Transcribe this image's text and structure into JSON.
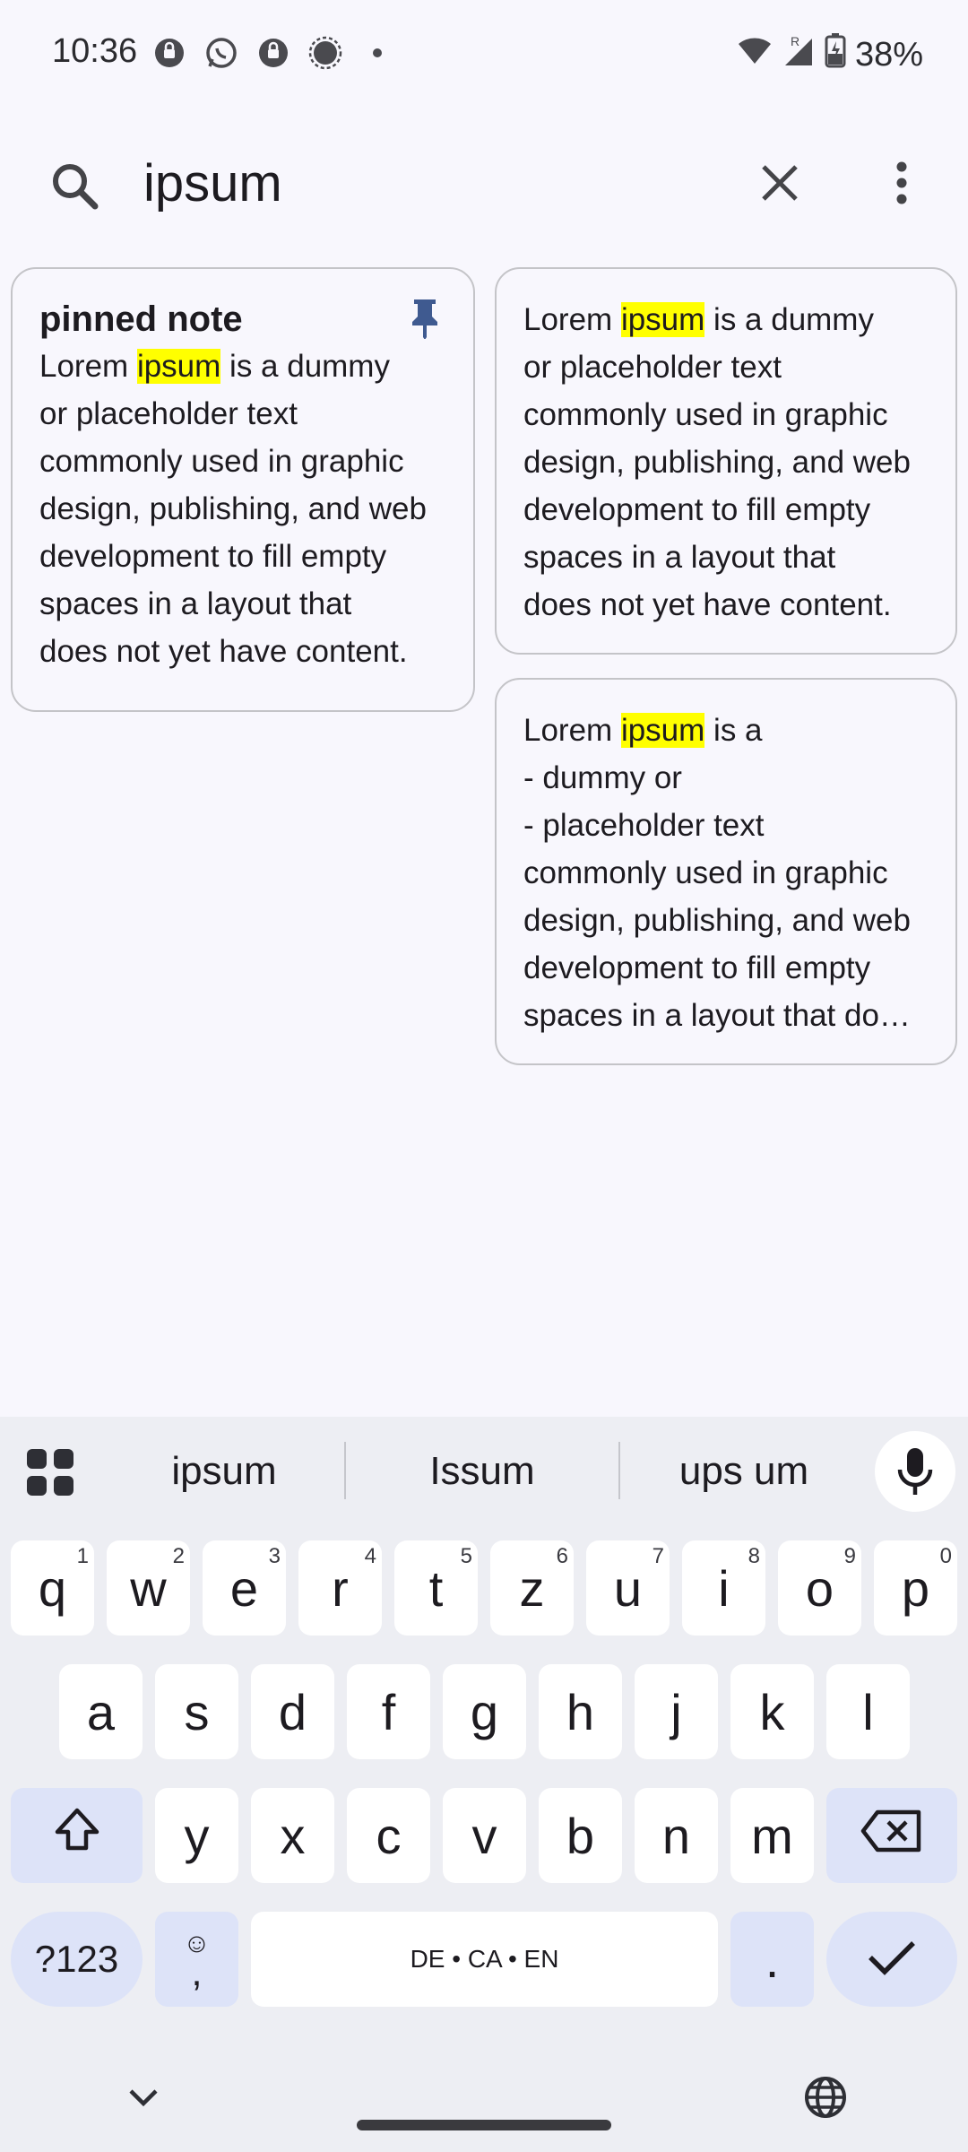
{
  "status_bar": {
    "time": "10:36",
    "battery": "38%",
    "notification_icons": [
      "signal-chat-icon",
      "whatsapp-icon",
      "signal-chat-icon",
      "signal-icon",
      "dot-icon"
    ],
    "right_icons": [
      "wifi-icon",
      "cellular-roaming-icon",
      "battery-charging-icon"
    ]
  },
  "search": {
    "query": "ipsum",
    "icons": {
      "search": "search-icon",
      "clear": "close-icon",
      "menu": "more-vert-icon"
    }
  },
  "notes": [
    {
      "title": "pinned note",
      "pinned": true,
      "body_before": "Lorem ",
      "body_match": "ipsum",
      "body_after": " is a dummy\nor placeholder text\ncommonly used in graphic\ndesign, publishing, and web\ndevelopment to fill empty\nspaces in a layout that\ndoes not yet have content."
    },
    {
      "title": "",
      "pinned": false,
      "body_before": "Lorem ",
      "body_match": "ipsum",
      "body_after": " is a dummy\nor placeholder text\ncommonly used in graphic\ndesign, publishing, and web\ndevelopment to fill empty\nspaces in a layout that\ndoes not yet have content."
    },
    {
      "title": "",
      "pinned": false,
      "body_before": "Lorem ",
      "body_match": "ipsum",
      "body_after": " is a\n- dummy or\n- placeholder text\ncommonly used in graphic\ndesign, publishing, and web\ndevelopment to fill empty\nspaces in a layout that do…"
    }
  ],
  "colors": {
    "highlight": "#ffff00",
    "pin": "#3f5a90",
    "background": "#f8f7fd",
    "keyboard_bg": "#edeef3",
    "function_key": "#dde3f8"
  },
  "keyboard": {
    "suggestions": [
      "ipsum",
      "Issum",
      "ups um"
    ],
    "row1": [
      {
        "key": "q",
        "hint": "1"
      },
      {
        "key": "w",
        "hint": "2"
      },
      {
        "key": "e",
        "hint": "3"
      },
      {
        "key": "r",
        "hint": "4"
      },
      {
        "key": "t",
        "hint": "5"
      },
      {
        "key": "z",
        "hint": "6"
      },
      {
        "key": "u",
        "hint": "7"
      },
      {
        "key": "i",
        "hint": "8"
      },
      {
        "key": "o",
        "hint": "9"
      },
      {
        "key": "p",
        "hint": "0"
      }
    ],
    "row2": [
      "a",
      "s",
      "d",
      "f",
      "g",
      "h",
      "j",
      "k",
      "l"
    ],
    "row3": [
      "y",
      "x",
      "c",
      "v",
      "b",
      "n",
      "m"
    ],
    "symbols_label": "?123",
    "emoji_label": "☺",
    "comma_label": ",",
    "space_label": "DE • CA • EN",
    "period_label": ".",
    "icons": {
      "apps": "apps-grid-icon",
      "mic": "mic-icon",
      "shift": "shift-icon",
      "backspace": "backspace-icon",
      "enter": "checkmark-icon",
      "hide": "chevron-down-icon",
      "language": "globe-icon"
    }
  }
}
